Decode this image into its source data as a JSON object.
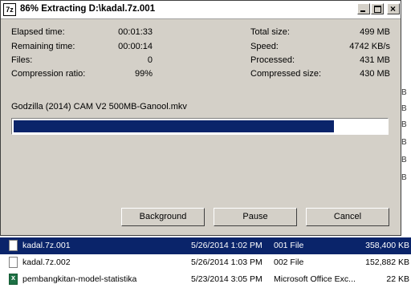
{
  "window": {
    "title": "86% Extracting D:\\kadal.7z.001",
    "app_icon_text": "7z"
  },
  "stats_left": [
    {
      "label": "Elapsed time:",
      "value": "00:01:33"
    },
    {
      "label": "Remaining time:",
      "value": "00:00:14"
    },
    {
      "label": "Files:",
      "value": "0"
    },
    {
      "label": "Compression ratio:",
      "value": "99%"
    }
  ],
  "stats_right": [
    {
      "label": "Total size:",
      "value": "499 MB"
    },
    {
      "label": "Speed:",
      "value": "4742 KB/s"
    },
    {
      "label": "Processed:",
      "value": "431 MB"
    },
    {
      "label": "Compressed size:",
      "value": "430 MB"
    }
  ],
  "current_file": "Godzilla (2014) CAM V2 500MB-Ganool.mkv",
  "progress": 0.86,
  "buttons": {
    "background": "Background",
    "pause": "Pause",
    "cancel": "Cancel"
  },
  "background_edge_letters": [
    "B",
    "B",
    "B",
    "B",
    "B",
    "B"
  ],
  "files": [
    {
      "name": "kadal.7z.001",
      "date": "5/26/2014 1:02 PM",
      "type": "001 File",
      "size": "358,400 KB",
      "icon": "file-icon",
      "selected": true
    },
    {
      "name": "kadal.7z.002",
      "date": "5/26/2014 1:03 PM",
      "type": "002 File",
      "size": "152,882 KB",
      "icon": "file-icon",
      "selected": false
    },
    {
      "name": "pembangkitan-model-statistika",
      "date": "5/23/2014 3:05 PM",
      "type": "Microsoft Office Exc...",
      "size": "22 KB",
      "icon": "excel-file-icon",
      "selected": false
    }
  ],
  "colors": {
    "progress_fill": "#0a246a",
    "selection": "#0a246a",
    "dialog_face": "#d4d0c8"
  }
}
